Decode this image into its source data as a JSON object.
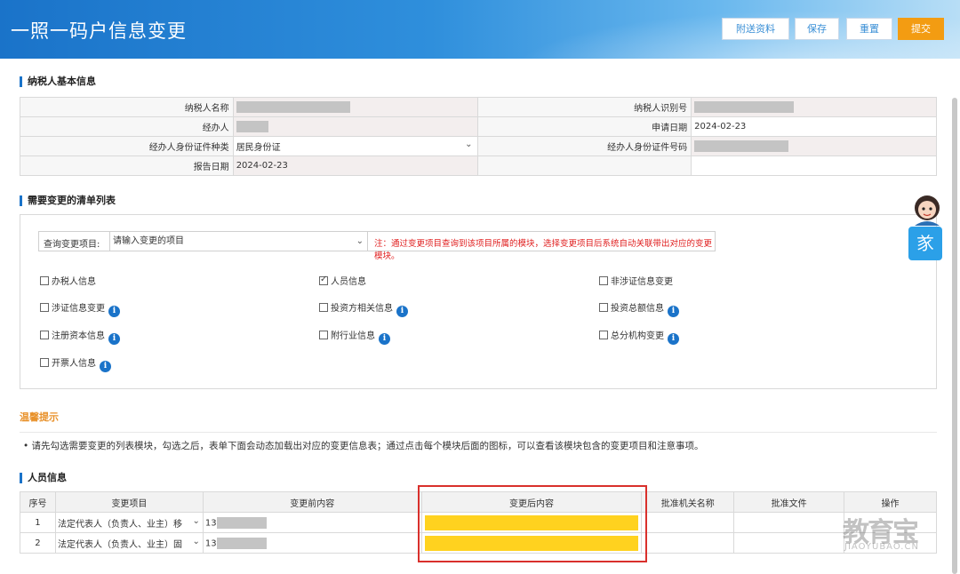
{
  "header": {
    "title": "一照一码户信息变更",
    "buttons": [
      "附送资料",
      "保存",
      "重置",
      "提交"
    ]
  },
  "basic_info": {
    "section_title": "纳税人基本信息",
    "rows": [
      {
        "l1": "纳税人名称",
        "v1": "",
        "l2": "纳税人识别号",
        "v2": ""
      },
      {
        "l1": "经办人",
        "v1": "",
        "l2": "申请日期",
        "v2": "2024-02-23"
      },
      {
        "l1": "经办人身份证件种类",
        "v1": "居民身份证",
        "l2": "经办人身份证件号码",
        "v2": ""
      },
      {
        "l1": "报告日期",
        "v1": "2024-02-23",
        "l2": "",
        "v2": ""
      }
    ]
  },
  "change_list": {
    "section_title": "需要变更的清单列表",
    "query_label": "查询变更项目:",
    "query_placeholder": "请输入变更的项目",
    "note": "注：通过变更项目查询到该项目所属的模块，选择变更项目后系统自动关联带出对应的变更模块。",
    "options": [
      {
        "label": "办税人信息",
        "checked": false,
        "info": false
      },
      {
        "label": "人员信息",
        "checked": true,
        "info": false
      },
      {
        "label": "非涉证信息变更",
        "checked": false,
        "info": false
      },
      {
        "label": "涉证信息变更",
        "checked": false,
        "info": true
      },
      {
        "label": "投资方相关信息",
        "checked": false,
        "info": true
      },
      {
        "label": "投资总额信息",
        "checked": false,
        "info": true
      },
      {
        "label": "注册资本信息",
        "checked": false,
        "info": true
      },
      {
        "label": "附行业信息",
        "checked": false,
        "info": true
      },
      {
        "label": "总分机构变更",
        "checked": false,
        "info": true
      },
      {
        "label": "开票人信息",
        "checked": false,
        "info": true
      }
    ]
  },
  "warm_tip": {
    "title": "温馨提示",
    "text": "请先勾选需要变更的列表模块，勾选之后，表单下面会动态加载出对应的变更信息表；通过点击每个模块后面的图标，可以查看该模块包含的变更项目和注意事项。"
  },
  "personnel": {
    "section_title": "人员信息",
    "columns": [
      "序号",
      "变更项目",
      "变更前内容",
      "变更后内容",
      "批准机关名称",
      "批准文件",
      "操作"
    ],
    "rows": [
      {
        "no": "1",
        "item": "法定代表人（负责人、业主）移",
        "before": "13"
      },
      {
        "no": "2",
        "item": "法定代表人（负责人、业主）固",
        "before": "13"
      }
    ]
  },
  "side": {
    "chat_icon": "chat-assistant-icon",
    "help_glyph": "㒸"
  },
  "watermark": {
    "big": "教育宝",
    "small": "JIAOYUBAO.CN"
  },
  "colors": {
    "brand": "#1a73c9",
    "submit": "#f39c12",
    "highlight": "#ffd21f",
    "note": "#e02020"
  }
}
